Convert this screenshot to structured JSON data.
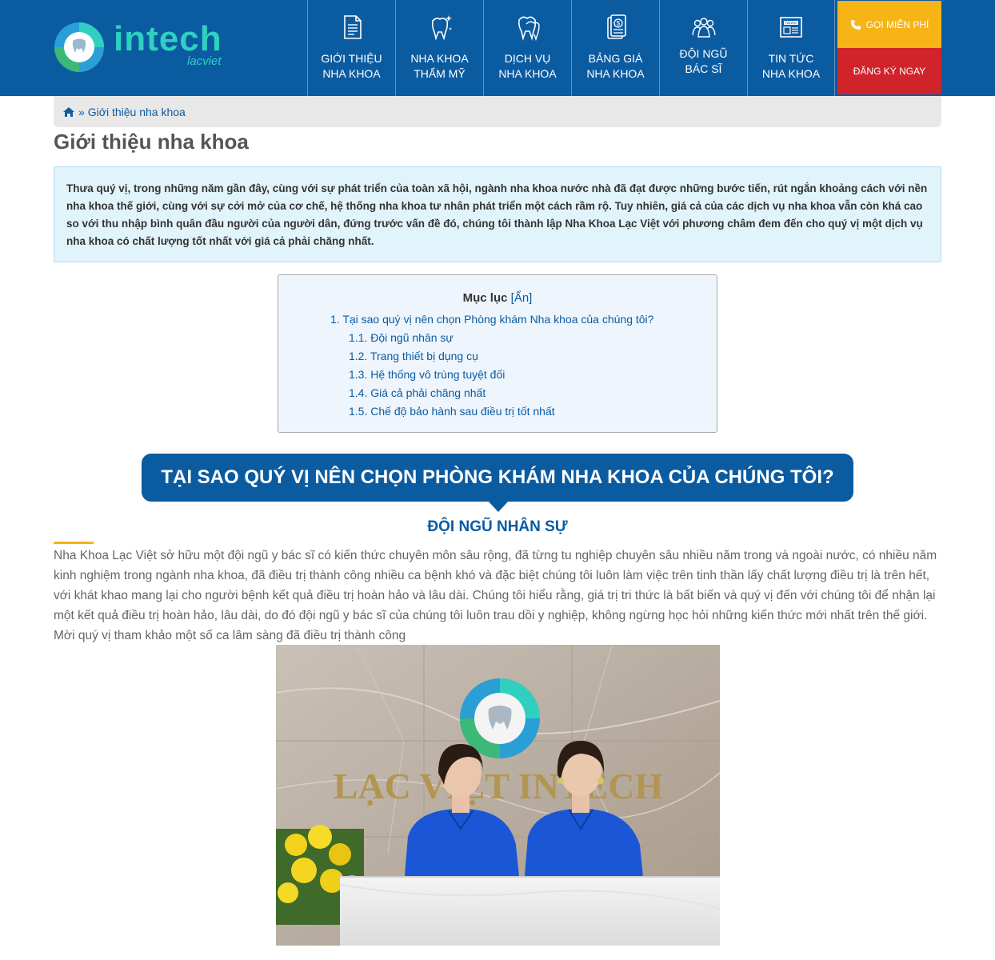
{
  "header": {
    "logo_text": "intech",
    "logo_sub": "lacviet",
    "nav": [
      {
        "line1": "Giới thiệu",
        "line2": "nha khoa",
        "icon": "document-icon"
      },
      {
        "line1": "Nha khoa",
        "line2": "thẩm mỹ",
        "icon": "sparkle-tooth-icon"
      },
      {
        "line1": "Dịch vụ",
        "line2": "nha khoa",
        "icon": "tooth-icon"
      },
      {
        "line1": "Bảng giá",
        "line2": "nha khoa",
        "icon": "price-list-icon"
      },
      {
        "line1": "Đội ngũ",
        "line2": "bác sĩ",
        "icon": "team-icon"
      },
      {
        "line1": "Tin tức",
        "line2": "nha khoa",
        "icon": "news-icon"
      }
    ],
    "call_label": "Gọi miễn phí",
    "register_label": "Đăng ký ngay",
    "colors": {
      "primary": "#0b5ba1",
      "call": "#f6b417",
      "register": "#d1232a"
    }
  },
  "breadcrumb": {
    "current": "Giới thiệu nha khoa",
    "separator": "»"
  },
  "page_title": "Giới thiệu nha khoa",
  "intro": "Thưa quý vị, trong những năm gần đây, cùng với sự phát triển của toàn xã hội, ngành nha khoa nước nhà đã đạt được những bước tiến, rút ngắn khoảng cách với nền nha khoa thế giới, cùng với sự cởi mở của cơ chế, hệ thống nha khoa tư nhân phát triển một cách rầm rộ. Tuy nhiên, giá cả của các dịch vụ nha khoa vẫn còn khá cao so với thu nhập bình quân đầu người của người dân, đứng trước vấn đề đó, chúng tôi thành lập Nha Khoa Lạc Việt với phương châm đem đến cho quý vị một dịch vụ nha khoa có chất lượng tốt nhất với giá cả phải chăng nhất.",
  "toc": {
    "title": "Mục lục",
    "toggle": "[Ẩn]",
    "items": [
      "1. Tại sao quý vị nên chọn Phòng khám Nha khoa của chúng tôi?",
      "1.1. Đội ngũ nhân sự",
      "1.2. Trang thiết bị dụng cụ",
      "1.3. Hệ thống vô trùng tuyệt đối",
      "1.4. Giá cả phải chăng nhất",
      "1.5. Chế độ bảo hành sau điều trị tốt nhất"
    ]
  },
  "section_heading": "Tại sao quý vị nên chọn Phòng khám Nha khoa của chúng tôi?",
  "sub_heading": "Đội ngũ nhân sự",
  "body": "Nha Khoa Lạc Việt sở hữu một đội ngũ y bác sĩ có kiến thức chuyên môn sâu rộng, đã từng tu nghiệp chuyên sâu nhiều năm trong và ngoài nước, có nhiều năm kinh nghiệm trong ngành nha khoa, đã điều trị thành công nhiều ca bệnh khó và đặc biệt chúng tôi luôn làm việc trên tinh thần lấy chất lượng điều trị là trên hết, với khát khao mang lại cho người bệnh kết quả điều trị hoàn hảo và lâu dài. Chúng tôi hiểu rằng, giá trị tri thức là bất biến và quý vị đến với chúng tôi để nhận lại một kết quả điều trị hoàn hảo, lâu dài, do đó đội ngũ y bác sĩ của chúng tôi luôn trau dồi y nghiệp, không ngừng học hỏi những kiến thức mới nhất trên thế giới. Mời quý vị tham khảo một số ca lâm sàng đã điều trị thành công",
  "photo": {
    "wall_text": "LẠC VIỆT INTECH"
  }
}
